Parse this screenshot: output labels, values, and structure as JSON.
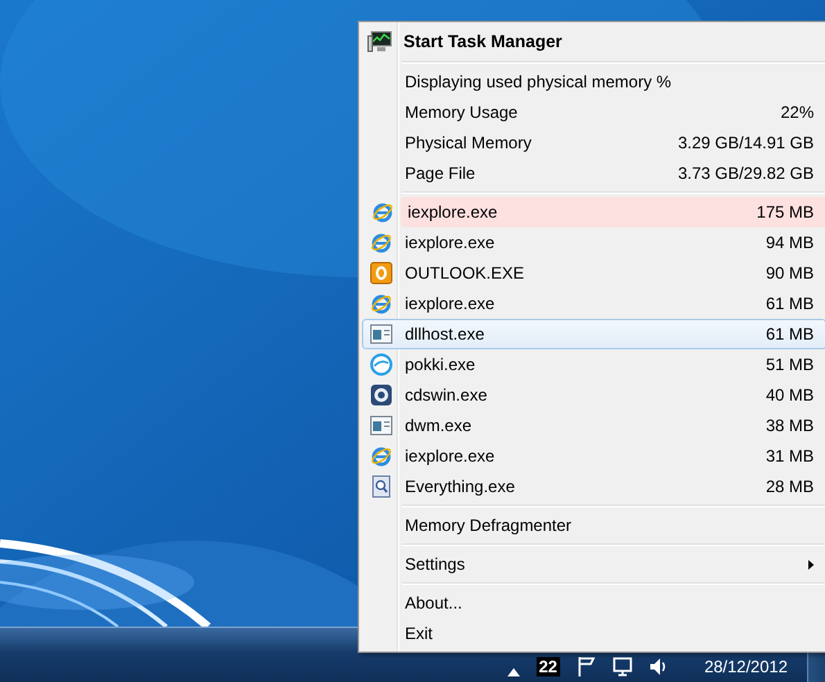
{
  "menu": {
    "header": {
      "label": "Start Task Manager"
    },
    "status": "Displaying used physical memory %",
    "stats": [
      {
        "label": "Memory Usage",
        "value": "22%"
      },
      {
        "label": "Physical Memory",
        "value": "3.29 GB/14.91 GB"
      },
      {
        "label": "Page File",
        "value": "3.73 GB/29.82 GB"
      }
    ],
    "processes": [
      {
        "name": "iexplore.exe",
        "memory": "175 MB",
        "kind": "ie",
        "alert": true,
        "selected": false
      },
      {
        "name": "iexplore.exe",
        "memory": "94 MB",
        "kind": "ie",
        "alert": false,
        "selected": false
      },
      {
        "name": "OUTLOOK.EXE",
        "memory": "90 MB",
        "kind": "outlook",
        "alert": false,
        "selected": false
      },
      {
        "name": "iexplore.exe",
        "memory": "61 MB",
        "kind": "ie",
        "alert": false,
        "selected": false
      },
      {
        "name": "dllhost.exe",
        "memory": "61 MB",
        "kind": "window",
        "alert": false,
        "selected": true
      },
      {
        "name": "pokki.exe",
        "memory": "51 MB",
        "kind": "pokki",
        "alert": false,
        "selected": false
      },
      {
        "name": "cdswin.exe",
        "memory": "40 MB",
        "kind": "disc",
        "alert": false,
        "selected": false
      },
      {
        "name": "dwm.exe",
        "memory": "38 MB",
        "kind": "window",
        "alert": false,
        "selected": false
      },
      {
        "name": "iexplore.exe",
        "memory": "31 MB",
        "kind": "ie",
        "alert": false,
        "selected": false
      },
      {
        "name": "Everything.exe",
        "memory": "28 MB",
        "kind": "search",
        "alert": false,
        "selected": false
      }
    ],
    "groups": [
      {
        "items": [
          {
            "label": "Memory Defragmenter",
            "submenu": false
          }
        ]
      },
      {
        "items": [
          {
            "label": "Settings",
            "submenu": true
          }
        ]
      },
      {
        "items": [
          {
            "label": "About...",
            "submenu": false
          },
          {
            "label": "Exit",
            "submenu": false
          }
        ]
      }
    ]
  },
  "taskbar": {
    "tray_badge": "22",
    "date": "28/12/2012"
  }
}
